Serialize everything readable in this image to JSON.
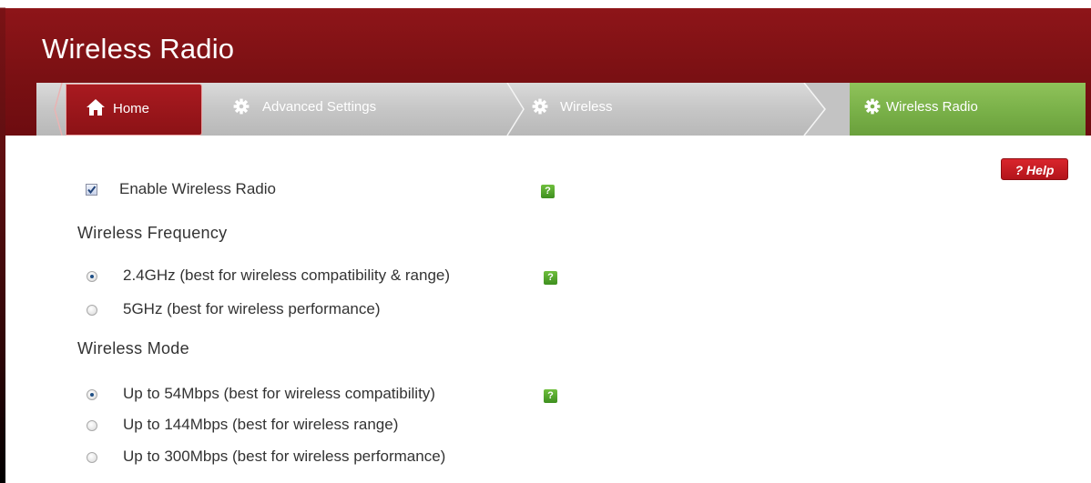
{
  "header": {
    "title": "Wireless Radio"
  },
  "breadcrumb": {
    "items": [
      {
        "label": "Home",
        "icon": "home-icon"
      },
      {
        "label": "Advanced Settings",
        "icon": "gear-icon"
      },
      {
        "label": "Wireless",
        "icon": "gear-icon"
      },
      {
        "label": "Wireless Radio",
        "icon": "gear-icon"
      }
    ]
  },
  "help": {
    "label": "? Help"
  },
  "enable": {
    "label": "Enable Wireless Radio",
    "checked": true,
    "help_glyph": "?"
  },
  "frequency": {
    "title": "Wireless Frequency",
    "options": [
      {
        "label": "2.4GHz (best for wireless compatibility & range)",
        "selected": true
      },
      {
        "label": "5GHz (best for wireless performance)",
        "selected": false
      }
    ],
    "help_glyph": "?"
  },
  "mode": {
    "title": "Wireless Mode",
    "options": [
      {
        "label": "Up to 54Mbps (best for wireless compatibility)",
        "selected": true
      },
      {
        "label": "Up to 144Mbps (best for wireless range)",
        "selected": false
      },
      {
        "label": "Up to 300Mbps (best for wireless performance)",
        "selected": false
      }
    ],
    "help_glyph": "?"
  },
  "colors": {
    "header": "#7a1013",
    "breadcrumb_active": "#79b048",
    "breadcrumb_bg": "#c6c6c6",
    "help_button": "#c81d24",
    "help_badge": "#4fa02a"
  }
}
